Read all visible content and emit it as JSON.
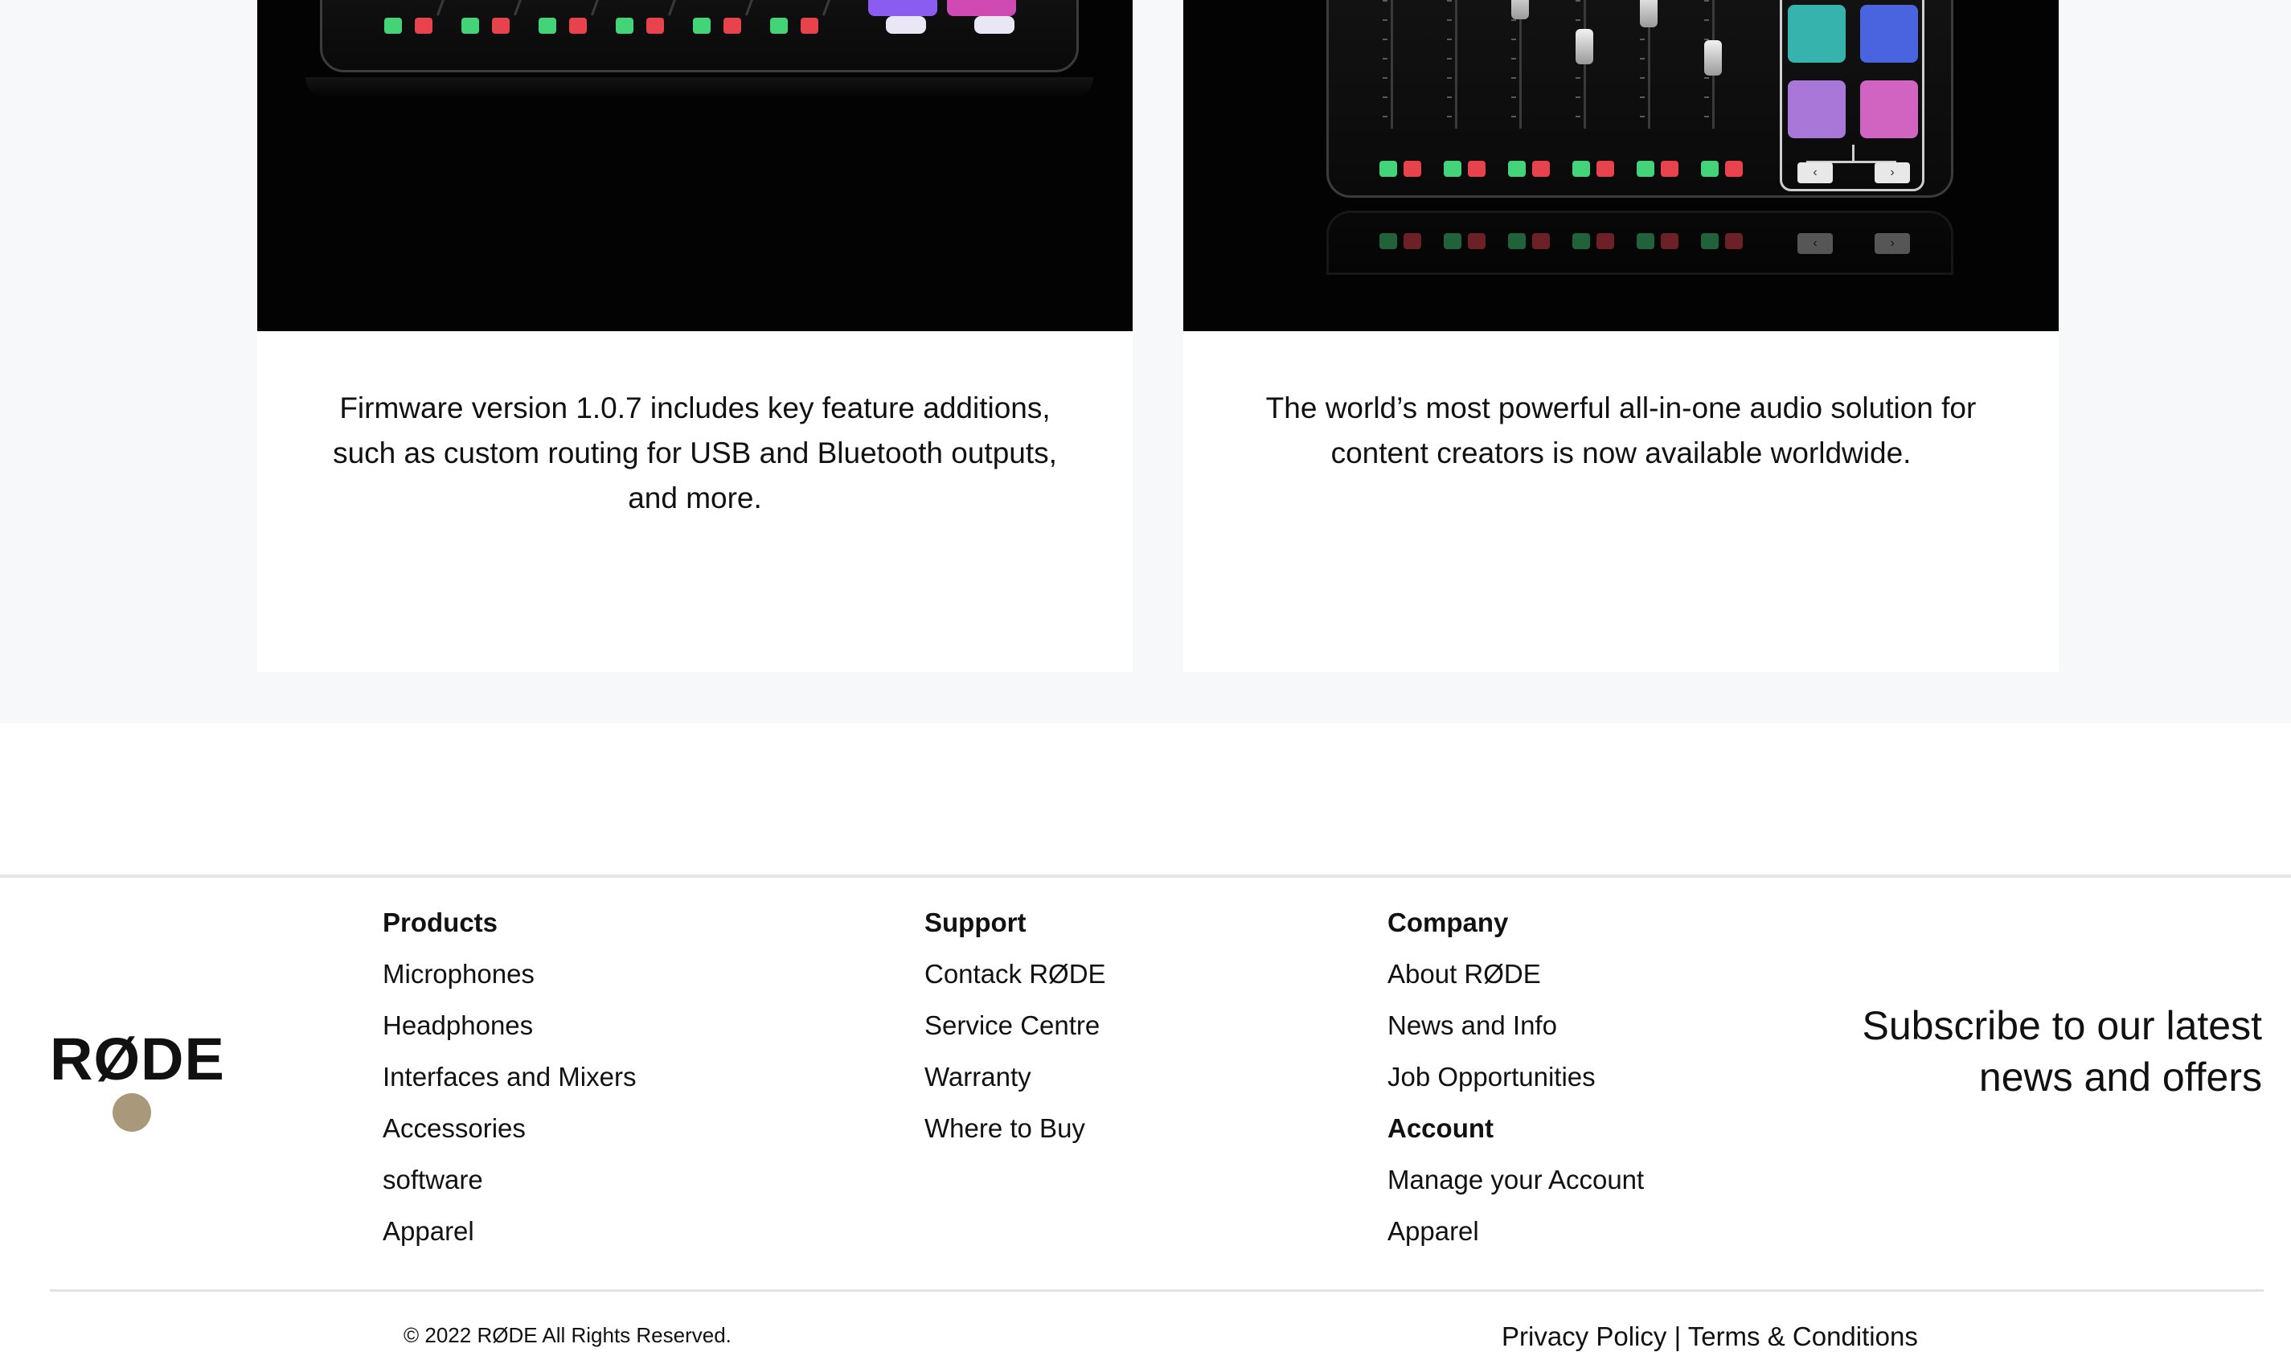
{
  "news": {
    "cards": [
      {
        "description": "Firmware version 1.0.7 includes key feature additions, such as custom routing for USB and Bluetooth outputs, and more."
      },
      {
        "description": "The world’s most powerful all-in-one audio solution for content creators is now available worldwide."
      }
    ]
  },
  "footer": {
    "logo_text": "RØDE",
    "products": {
      "heading": "Products",
      "links": [
        "Microphones",
        "Headphones",
        "Interfaces and Mixers",
        "Accessories",
        "software",
        "Apparel"
      ]
    },
    "support": {
      "heading": "Support",
      "links": [
        "Contack RØDE",
        "Service Centre",
        "Warranty",
        "Where to Buy"
      ]
    },
    "company": {
      "heading": "Company",
      "links": [
        "About RØDE",
        "News and Info",
        "Job Opportunities"
      ],
      "account_heading": "Account",
      "account_links": [
        "Manage your Account",
        "Apparel"
      ]
    },
    "subscribe_text": "Subscribe to our latest news and offers",
    "copyright": "© 2022 RØDE All Rights Reserved.",
    "privacy_label": "Privacy Policy",
    "separator": "|",
    "terms_label": "Terms & Conditions"
  },
  "colors": {
    "section_bg": "#f7f8fa",
    "logo_dot": "#a9987a",
    "button_green": "#45d37a",
    "button_red": "#e6434c"
  }
}
